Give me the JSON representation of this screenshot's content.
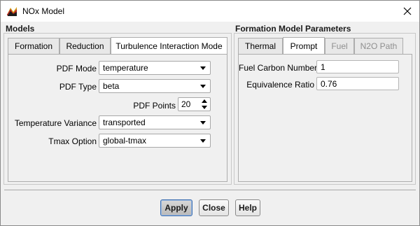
{
  "window": {
    "title": "NOx Model",
    "app_icon": "fluent-app-icon",
    "close_icon": "close-icon"
  },
  "models": {
    "section_title": "Models",
    "tabs": [
      {
        "label": "Formation",
        "active": false
      },
      {
        "label": "Reduction",
        "active": false
      },
      {
        "label": "Turbulence Interaction Mode",
        "active": true
      }
    ],
    "fields": {
      "pdf_mode": {
        "label": "PDF Mode",
        "value": "temperature"
      },
      "pdf_type": {
        "label": "PDF Type",
        "value": "beta"
      },
      "pdf_points": {
        "label": "PDF Points",
        "value": "20"
      },
      "temperature_variance": {
        "label": "Temperature Variance",
        "value": "transported"
      },
      "tmax_option": {
        "label": "Tmax Option",
        "value": "global-tmax"
      }
    }
  },
  "formation_params": {
    "section_title": "Formation Model Parameters",
    "tabs": [
      {
        "label": "Thermal",
        "active": false,
        "enabled": true
      },
      {
        "label": "Prompt",
        "active": true,
        "enabled": true
      },
      {
        "label": "Fuel",
        "active": false,
        "enabled": false
      },
      {
        "label": "N2O Path",
        "active": false,
        "enabled": false
      }
    ],
    "fields": {
      "fuel_carbon_number": {
        "label": "Fuel Carbon Number",
        "value": "1"
      },
      "equivalence_ratio": {
        "label": "Equivalence Ratio",
        "value": "0.76"
      }
    }
  },
  "buttons": {
    "apply": "Apply",
    "close": "Close",
    "help": "Help"
  }
}
